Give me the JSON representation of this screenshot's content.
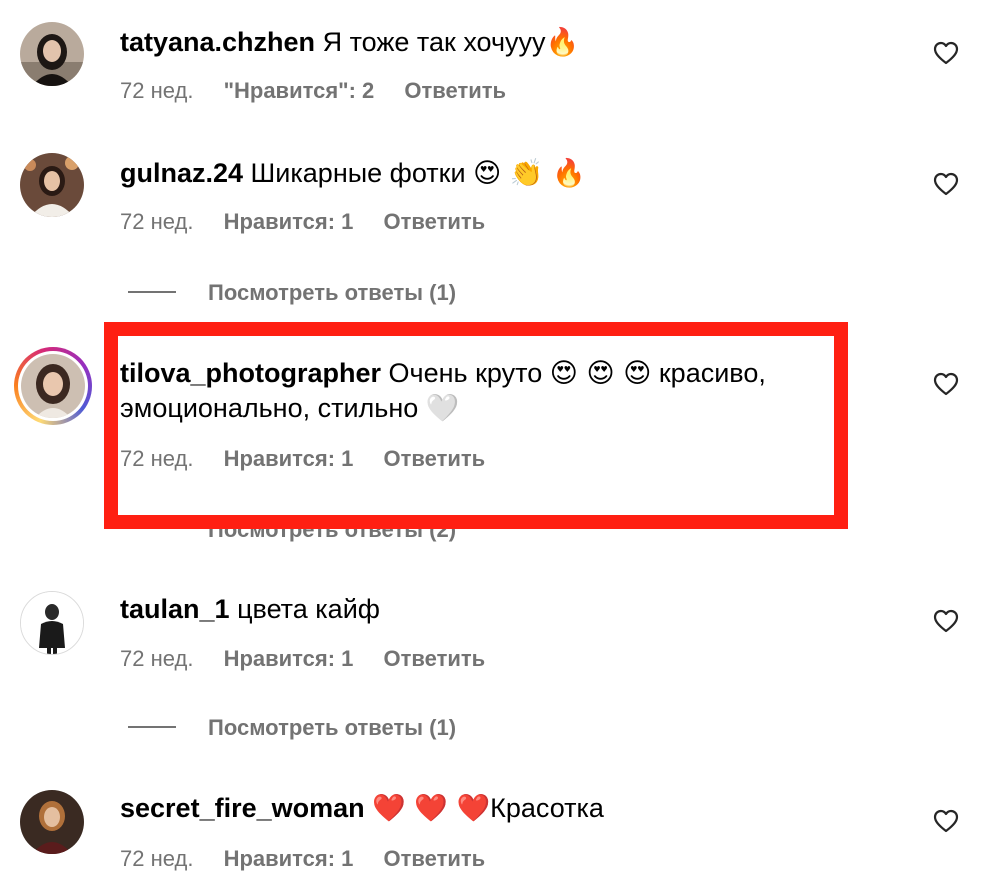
{
  "comments": [
    {
      "username": "tatyana.chzhen",
      "text": "Я тоже так хочууу",
      "emoji": "🔥",
      "age": "72 нед.",
      "likes": "\"Нравится\": 2",
      "reply": "Ответить",
      "avatar_icon": "user-photo"
    },
    {
      "username": "gulnaz.24",
      "text": "Шикарные фотки",
      "emoji": "😍 👏 🔥",
      "age": "72 нед.",
      "likes": "Нравится: 1",
      "reply": "Ответить",
      "view_replies": "Посмотреть ответы (1)",
      "avatar_icon": "user-photo"
    },
    {
      "username": "tilova_photographer",
      "text": "Очень круто",
      "emoji": "😍 😍 😍",
      "text_tail": "красиво,",
      "line2": "эмоционально, стильно",
      "emoji2": "🤍",
      "age": "72 нед.",
      "likes": "Нравится: 1",
      "reply": "Ответить",
      "view_replies": "Посмотреть ответы (2)",
      "avatar_icon": "user-photo-story-ring"
    },
    {
      "username": "taulan_1",
      "text": "цвета кайф",
      "age": "72 нед.",
      "likes": "Нравится: 1",
      "reply": "Ответить",
      "view_replies": "Посмотреть ответы (1)",
      "avatar_icon": "user-photo"
    },
    {
      "username": "secret_fire_woman",
      "emoji": "❤️ ❤️ ❤️",
      "text": "Красотка",
      "age": "72 нед.",
      "likes": "Нравится: 1",
      "reply": "Ответить",
      "avatar_icon": "user-photo"
    }
  ],
  "colors": {
    "secondary_text": "#737373",
    "highlight_border": "#ff1f12",
    "heart_stroke": "#262626"
  }
}
